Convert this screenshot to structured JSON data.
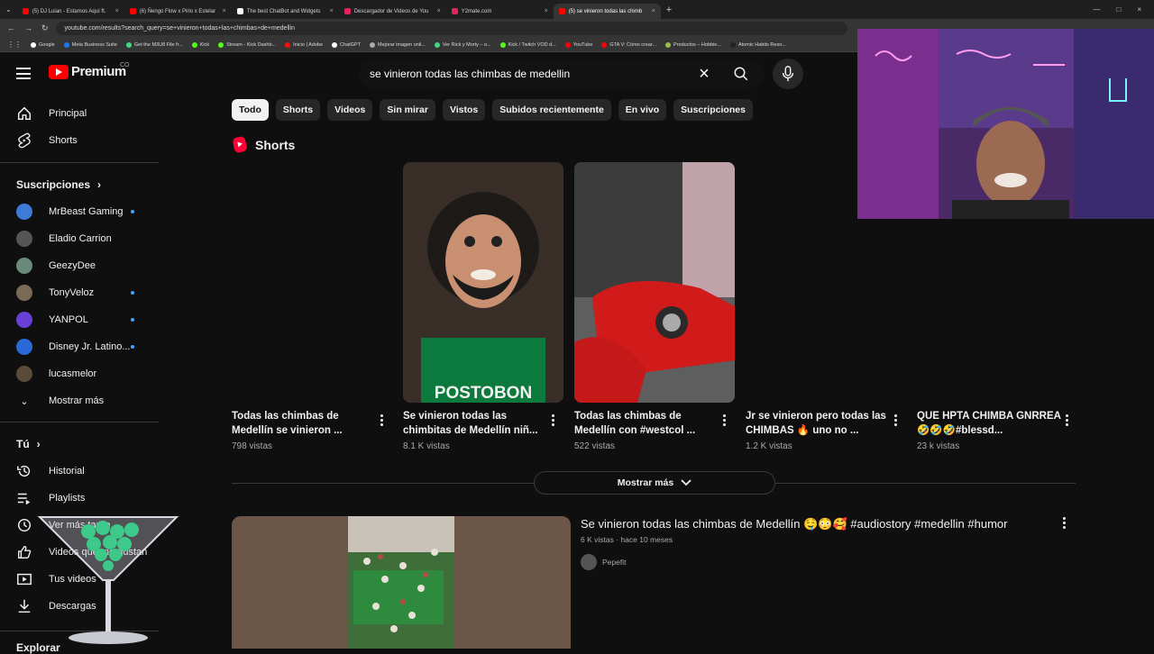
{
  "browser": {
    "tabs": [
      {
        "label": "(5) DJ Luian - Estamos Aquí ft.",
        "favicon_color": "#ff0000"
      },
      {
        "label": "(6) Ñengo Flow x Pirlo x Estelar",
        "favicon_color": "#ff0000"
      },
      {
        "label": "The best ChatBot and Widgets",
        "favicon_color": "#ffffff"
      },
      {
        "label": "Descargador de Videos de You",
        "favicon_color": "#e0245e"
      },
      {
        "label": "Y2mate.com",
        "favicon_color": "#e0245e"
      },
      {
        "label": "(5) se vinieron todas las chimb",
        "favicon_color": "#ff0000"
      }
    ],
    "active_tab": 5,
    "url": "youtube.com/results?search_query=se+vinieron+todas+las+chimbas+de+medellin",
    "bookmarks": [
      {
        "label": "Google",
        "color": "#ffffff"
      },
      {
        "label": "Meta Business Suite",
        "color": "#1877f2"
      },
      {
        "label": "Get the M3U8 File fr...",
        "color": "#3ddc84"
      },
      {
        "label": "Kick",
        "color": "#53fc18"
      },
      {
        "label": "Stream - Kick Dashb...",
        "color": "#53fc18"
      },
      {
        "label": "Inicio | Adobe",
        "color": "#fa0f00"
      },
      {
        "label": "ChatGPT",
        "color": "#ffffff"
      },
      {
        "label": "Mejorar imagen onli...",
        "color": "#aaaaaa"
      },
      {
        "label": "Ver Rick y Morty – o...",
        "color": "#3ddc84"
      },
      {
        "label": "Kick / Twitch VOD d...",
        "color": "#53fc18"
      },
      {
        "label": "YouTube",
        "color": "#ff0000"
      },
      {
        "label": "GTA V: Cómo crear...",
        "color": "#ff0000"
      },
      {
        "label": "Productos – Hobbie...",
        "color": "#96bf48"
      },
      {
        "label": "Atomic Habits Reso...",
        "color": "#222222"
      }
    ]
  },
  "masthead": {
    "brand": "Premium",
    "country": "CO",
    "search_query": "se vinieron todas las chimbas de medellin"
  },
  "sidebar": {
    "main": [
      {
        "label": "Principal",
        "icon": "home-icon"
      },
      {
        "label": "Shorts",
        "icon": "shorts-icon"
      }
    ],
    "subscriptions_heading": "Suscripciones",
    "subscriptions": [
      {
        "label": "MrBeast Gaming",
        "color": "#3d7bd6",
        "live": true
      },
      {
        "label": "Eladio Carrion",
        "color": "#555555",
        "live": false
      },
      {
        "label": "GeezyDee",
        "color": "#6a8a7a",
        "live": false
      },
      {
        "label": "TonyVeloz",
        "color": "#7a6a55",
        "live": true
      },
      {
        "label": "YANPOL",
        "color": "#6a3fd6",
        "live": true
      },
      {
        "label": "Disney Jr. Latino...",
        "color": "#2a6ad6",
        "live": true
      },
      {
        "label": "lucasmelor",
        "color": "#5a4a3a",
        "live": false
      }
    ],
    "show_more": "Mostrar más",
    "you_heading": "Tú",
    "you_items": [
      {
        "label": "Historial",
        "icon": "history-icon"
      },
      {
        "label": "Playlists",
        "icon": "playlists-icon"
      },
      {
        "label": "Ver más tarde",
        "icon": "watch-later-icon"
      },
      {
        "label": "Videos que me gustan",
        "icon": "like-icon"
      },
      {
        "label": "Tus videos",
        "icon": "your-videos-icon"
      },
      {
        "label": "Descargas",
        "icon": "download-icon"
      }
    ],
    "explore_heading": "Explorar"
  },
  "chips": [
    "Todo",
    "Shorts",
    "Videos",
    "Sin mirar",
    "Vistos",
    "Subidos recientemente",
    "En vivo",
    "Suscripciones"
  ],
  "shorts": {
    "heading": "Shorts",
    "items": [
      {
        "title": "Todas las chimbas de Medellín se vinieron ...",
        "views": "798 vistas"
      },
      {
        "title": "Se vinieron todas las chimbitas de Medellín niñ...",
        "views": "8.1 K vistas"
      },
      {
        "title": "Todas las chimbas de Medellín con #westcol ...",
        "views": "522 vistas"
      },
      {
        "title": "Jr se vinieron pero todas las CHIMBAS 🔥 uno no ...",
        "views": "1.2 K vistas"
      },
      {
        "title": "QUE HPTA CHIMBA GNRREA 🤣🤣🤣#blessd...",
        "views": "23 k vistas"
      }
    ],
    "show_more": "Mostrar más"
  },
  "video": {
    "title": "Se vinieron todas las chimbas de Medellín 🤤😳🥰 #audiostory #medellin #humor",
    "views": "6 K vistas",
    "age": "hace 10 meses",
    "channel": "Pepefit"
  },
  "colors": {
    "background": "#0f0f0f",
    "accent": "#ff0000",
    "chip_active": "#f1f1f1",
    "live_dot": "#3ea6ff"
  }
}
